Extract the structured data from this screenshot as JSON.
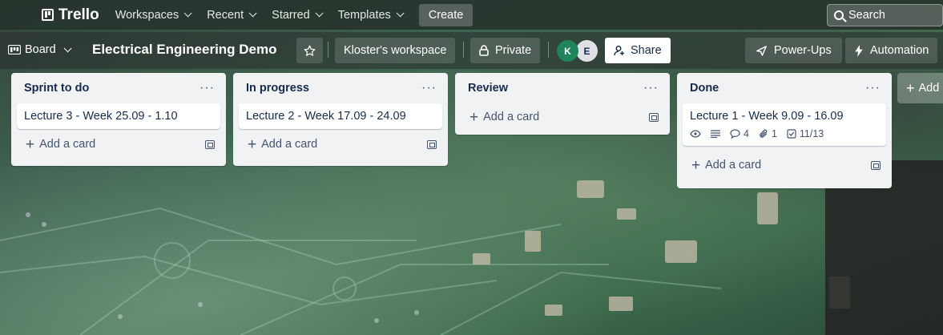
{
  "nav": {
    "logo": "Trello",
    "items": [
      {
        "label": "Workspaces"
      },
      {
        "label": "Recent"
      },
      {
        "label": "Starred"
      },
      {
        "label": "Templates"
      }
    ],
    "create_label": "Create",
    "search_placeholder": "Search"
  },
  "board": {
    "view_label": "Board",
    "title": "Electrical Engineering Demo",
    "workspace": "Kloster's workspace",
    "visibility": "Private",
    "members": [
      {
        "initial": "K",
        "color": "#1f845a"
      },
      {
        "initial": "E",
        "color": "#dfe1e6"
      }
    ],
    "share_label": "Share",
    "powerups_label": "Power-Ups",
    "automation_label": "Automation"
  },
  "lists": [
    {
      "title": "Sprint to do",
      "cards": [
        {
          "title": "Lecture 3 - Week 25.09 - 1.10"
        }
      ],
      "add_label": "Add a card"
    },
    {
      "title": "In progress",
      "cards": [
        {
          "title": "Lecture 2 - Week 17.09 - 24.09"
        }
      ],
      "add_label": "Add a card"
    },
    {
      "title": "Review",
      "cards": [],
      "add_label": "Add a card"
    },
    {
      "title": "Done",
      "cards": [
        {
          "title": "Lecture 1 - Week 9.09 - 16.09",
          "badges": {
            "comments": "4",
            "attachments": "1",
            "checklist": "11/13"
          }
        }
      ],
      "add_label": "Add a card"
    }
  ],
  "add_list_label": "Add",
  "colors": {
    "accent": "#0c66e4",
    "list_bg": "#f1f2f4",
    "text": "#172b4d"
  }
}
